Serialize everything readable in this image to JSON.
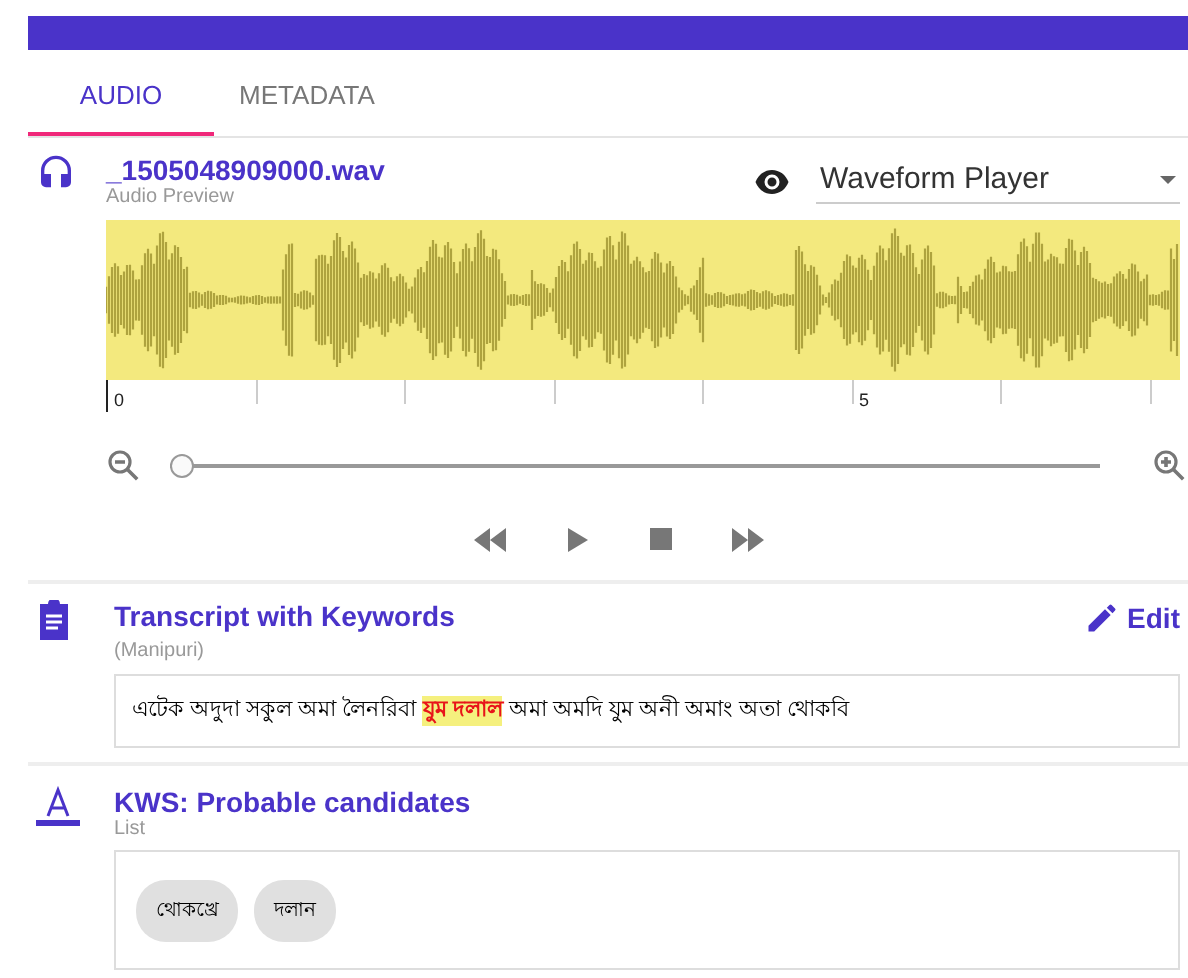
{
  "tabs": [
    {
      "label": "AUDIO",
      "selected": true
    },
    {
      "label": "METADATA",
      "selected": false
    }
  ],
  "audio": {
    "filename": "_1505048909000.wav",
    "subtitle": "Audio Preview",
    "player": "Waveform Player",
    "axis_labels": [
      "0",
      "5"
    ],
    "zoom": {
      "level": 0
    }
  },
  "transcript": {
    "title": "Transcript with Keywords",
    "language": "(Manipuri)",
    "edit": "Edit",
    "text": "এটেক অদুদা সকুল অমা লৈনরিবা **যুম দলাল** অমা অমদি যুম অনী অমাং অতা থোকবি"
  },
  "kws": {
    "title": "KWS: Probable candidates",
    "subtitle": "List",
    "chips": [
      "থোকখ্রে",
      "দলান"
    ]
  }
}
